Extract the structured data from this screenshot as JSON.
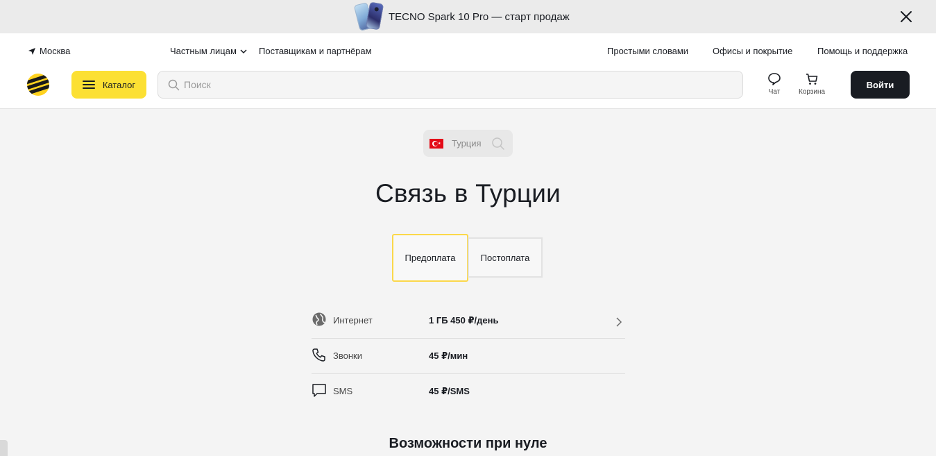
{
  "promo": {
    "text": "TECNO Spark 10 Pro — старт продаж",
    "image": "phone-promo-image",
    "close_icon": "close-icon"
  },
  "header": {
    "city": "Москва",
    "nav": {
      "private": "Частным лицам",
      "partners": "Поставщикам и партнёрам",
      "simple": "Простыми словами",
      "offices": "Офисы и покрытие",
      "help": "Помощь и поддержка"
    },
    "catalog_label": "Каталог",
    "search_placeholder": "Поиск",
    "chat_label": "Чат",
    "cart_label": "Корзина",
    "login_label": "Войти",
    "colors": {
      "brand_yellow": "#fce033",
      "dark": "#191c22"
    }
  },
  "main": {
    "country": "Турция",
    "title": "Связь в Турции",
    "tabs": [
      {
        "label": "Предоплата",
        "active": true
      },
      {
        "label": "Постоплата",
        "active": false
      }
    ],
    "rates": [
      {
        "icon": "globe-icon",
        "name": "Интернет",
        "value": "1 ГБ 450 ₽/день"
      },
      {
        "icon": "phone-icon",
        "name": "Звонки",
        "value": "45 ₽/мин"
      },
      {
        "icon": "message-icon",
        "name": "SMS",
        "value": "45 ₽/SMS"
      }
    ],
    "section_title": "Возможности при нуле"
  }
}
